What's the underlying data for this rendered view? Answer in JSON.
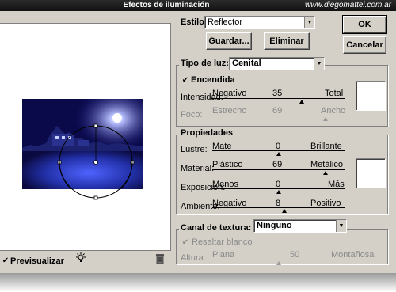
{
  "title": "Efectos de iluminación",
  "watermark": "www.diegomattei.com.ar",
  "estilo": {
    "label": "Estilo:",
    "value": "Reflector"
  },
  "buttons": {
    "ok": "OK",
    "cancel": "Cancelar",
    "save": "Guardar...",
    "delete": "Eliminar"
  },
  "light_type": {
    "label": "Tipo de luz:",
    "value": "Cenital",
    "encendida": "Encendida",
    "intensidad": {
      "label": "Intensidad:",
      "min": "Negativo",
      "value": "35",
      "max": "Total",
      "level": 0.67
    },
    "foco": {
      "label": "Foco:",
      "min": "Estrecho",
      "value": "69",
      "max": "Ancho",
      "level": 0.85
    }
  },
  "properties": {
    "title": "Propiedades",
    "lustre": {
      "label": "Lustre:",
      "min": "Mate",
      "value": "0",
      "max": "Brillante",
      "level": 0.5
    },
    "material": {
      "label": "Material:",
      "min": "Plástico",
      "value": "69",
      "max": "Metálico",
      "level": 0.85
    },
    "exposicion": {
      "label": "Exposición:",
      "min": "Menos",
      "value": "0",
      "max": "Más",
      "level": 0.5
    },
    "ambiente": {
      "label": "Ambiente:",
      "min": "Negativo",
      "value": "8",
      "max": "Positivo",
      "level": 0.54
    }
  },
  "texture": {
    "label": "Canal de textura:",
    "value": "Ninguno",
    "resaltar": "Resaltar blanco",
    "altura": {
      "label": "Altura:",
      "min": "Plana",
      "value": "50",
      "max": "Montañosa",
      "level": 0.5
    }
  },
  "preview_label": "Previsualizar",
  "colors": {
    "scene_dark": "#08083a",
    "scene_light": "#3a49d8"
  }
}
